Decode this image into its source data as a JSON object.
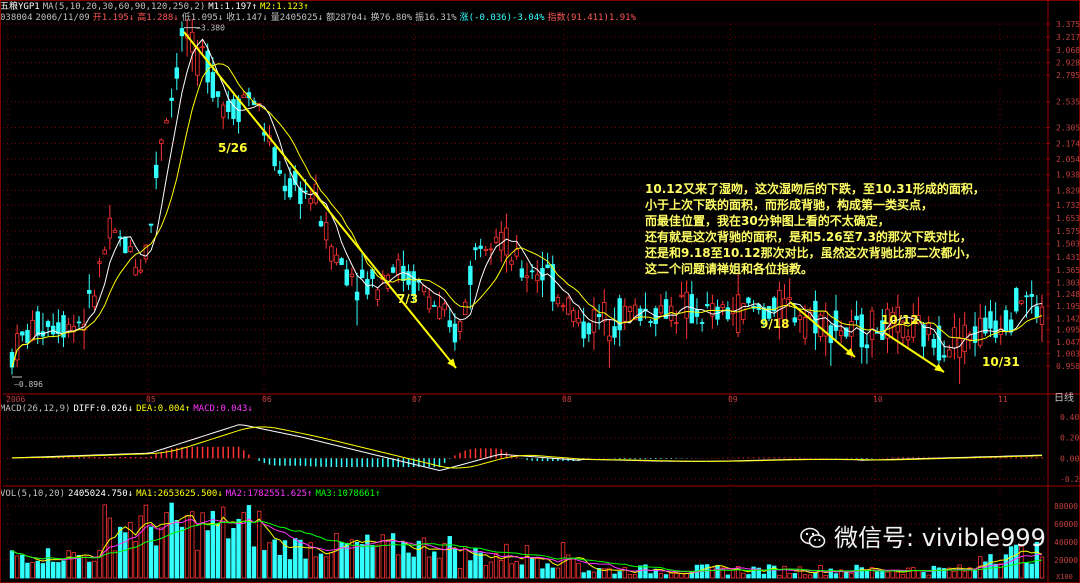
{
  "header": {
    "main": {
      "symbol": "五粮YGP1",
      "ma_params": "MA(5,10,20,30,60,90,120,250,2)",
      "m1": "M1:1.197↑",
      "m2": "M2:1.123↑",
      "code": "038004",
      "date": "2006/11/09",
      "open": "开1.195↓",
      "high": "高1.288↓",
      "low": "低1.095↓",
      "close": "收1.147↓",
      "volume": "量2405025↓",
      "amount": "额28704↓",
      "turnover": "换76.80%",
      "amplitude": "振16.31%",
      "change": "涨(-0.036)-3.04%",
      "index": "指数(91.411)1.91%"
    },
    "macd": {
      "params": "MACD(26,12,9)",
      "diff": "DIFF:0.026↓",
      "dea": "DEA:0.004↑",
      "macd": "MACD:0.043↓"
    },
    "vol": {
      "params": "VOL(5,10,20)",
      "vol": "2405024.750↓",
      "ma1": "MA1:2653625.500↓",
      "ma2": "MA2:1782551.625↑",
      "ma3": "MA3:1078661↑"
    }
  },
  "price_axis": [
    "3.375",
    "3.217",
    "3.068",
    "2.928",
    "2.795",
    "2.535",
    "2.305",
    "2.174",
    "2.054",
    "1.938",
    "1.829",
    "1.732",
    "1.653",
    "1.575",
    "1.503",
    "1.431",
    "1.365",
    "1.303",
    "1.248",
    "1.195",
    "1.142",
    "1.095",
    "1.047",
    "1.003",
    "0.958"
  ],
  "macd_axis": [
    "0.40",
    "0.20",
    "0.00",
    "-0.20"
  ],
  "vol_axis": [
    "80000",
    "60000",
    "40000",
    "20000",
    "X100"
  ],
  "x_axis": [
    "2006",
    "05",
    "06",
    "07",
    "08",
    "09",
    "10",
    "11"
  ],
  "period_label": "日线",
  "extremes": {
    "high": "3.380",
    "low": "0.896"
  },
  "annotations": {
    "d526": "5/26",
    "d73": "7/3",
    "d918": "9/18",
    "d1012": "10/12",
    "d1031": "10/31"
  },
  "note_lines": [
    "10.12又来了湿吻，这次湿吻后的下跌，至10.31形成的面积，",
    "小于上次下跌的面积，而形成背驰，构成第一类买点，",
    "而最佳位置，我在30分钟图上看的不太确定，",
    "还有就是这次背驰的面积，是和5.26至7.3的那次下跌对比，",
    "还是和9.18至10.12那次对比，虽然这次背驰比那二次都小，",
    "这二个问题请禅姐和各位指教。"
  ],
  "watermark": "微信号: vivible999",
  "colors": {
    "up": "#ff3333",
    "down": "#33ffff",
    "grid": "#7a0000",
    "ma5": "#ffffff",
    "ma10": "#ffff00",
    "ma20": "#ff33ff",
    "ma30": "#00ff00",
    "arrow": "#ffff00"
  },
  "chart_data": {
    "type": "candlestick",
    "description_axis": "price axis labels as shown",
    "ylim": [
      0.896,
      3.38
    ],
    "ohlc_period": "daily",
    "volume_unit": "X100",
    "macd_ylim": [
      -0.25,
      0.45
    ]
  }
}
